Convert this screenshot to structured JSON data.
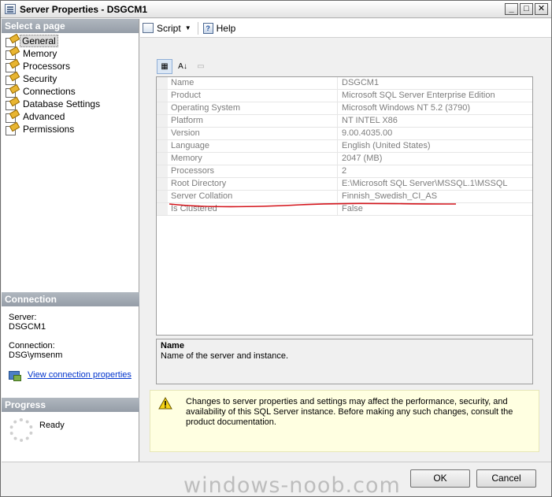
{
  "window": {
    "title": "Server Properties - DSGCM1",
    "min_glyph": "_",
    "max_glyph": "□",
    "close_glyph": "✕"
  },
  "left": {
    "select_page_header": "Select a page",
    "pages": [
      {
        "label": "General",
        "selected": true
      },
      {
        "label": "Memory",
        "selected": false
      },
      {
        "label": "Processors",
        "selected": false
      },
      {
        "label": "Security",
        "selected": false
      },
      {
        "label": "Connections",
        "selected": false
      },
      {
        "label": "Database Settings",
        "selected": false
      },
      {
        "label": "Advanced",
        "selected": false
      },
      {
        "label": "Permissions",
        "selected": false
      }
    ],
    "connection_header": "Connection",
    "server_label": "Server:",
    "server_value": "DSGCM1",
    "connection_label": "Connection:",
    "connection_value": "DSG\\ymsenm",
    "view_link": "View connection properties",
    "progress_header": "Progress",
    "progress_status": "Ready"
  },
  "toolbar": {
    "script_label": "Script",
    "help_label": "Help"
  },
  "propbar": {
    "categorized": "▦",
    "alphabetical": "A↓",
    "pages": "▭"
  },
  "properties": [
    {
      "name": "Name",
      "value": "DSGCM1"
    },
    {
      "name": "Product",
      "value": "Microsoft SQL Server Enterprise Edition"
    },
    {
      "name": "Operating System",
      "value": "Microsoft Windows NT 5.2 (3790)"
    },
    {
      "name": "Platform",
      "value": "NT INTEL X86"
    },
    {
      "name": "Version",
      "value": "9.00.4035.00"
    },
    {
      "name": "Language",
      "value": "English (United States)"
    },
    {
      "name": "Memory",
      "value": "2047 (MB)"
    },
    {
      "name": "Processors",
      "value": "2"
    },
    {
      "name": "Root Directory",
      "value": "E:\\Microsoft SQL Server\\MSSQL.1\\MSSQL"
    },
    {
      "name": "Server Collation",
      "value": "Finnish_Swedish_CI_AS"
    },
    {
      "name": "Is Clustered",
      "value": "False"
    }
  ],
  "description": {
    "title": "Name",
    "text": "Name of the server and instance."
  },
  "warning": {
    "text": "Changes to server properties and settings may affect the performance, security, and availability of this SQL Server instance. Before making any such changes, consult the product documentation."
  },
  "buttons": {
    "ok": "OK",
    "cancel": "Cancel"
  },
  "watermark": "windows-noob.com",
  "colors": {
    "annotation_red": "#d4141b",
    "header_gray": "#9ca4ae",
    "link_blue": "#0033cc",
    "warning_bg": "#ffffe1"
  }
}
